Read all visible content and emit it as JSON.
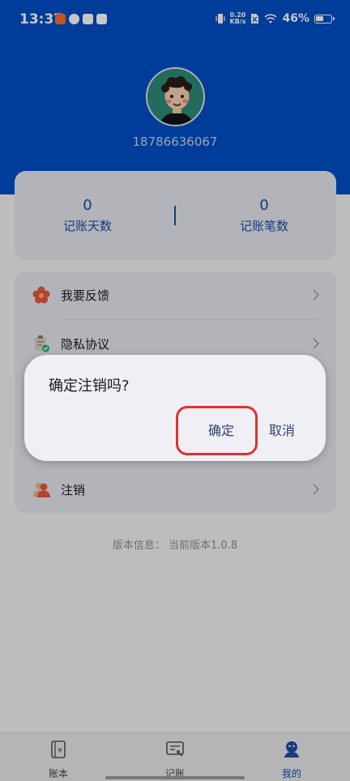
{
  "status": {
    "time": "13:37",
    "net_speed_value": "0.20",
    "net_speed_unit": "KB/s",
    "battery": "46%"
  },
  "profile": {
    "phone": "18786636067"
  },
  "stats": {
    "days_value": "0",
    "days_label": "记账天数",
    "entries_value": "0",
    "entries_label": "记账笔数"
  },
  "menu": {
    "items": [
      {
        "label": "我要反馈",
        "icon": "flower-icon"
      },
      {
        "label": "隐私协议",
        "icon": "clipboard-icon"
      },
      {
        "label": "注销",
        "icon": "users-icon"
      }
    ]
  },
  "version": "版本信息： 当前版本1.0.8",
  "dialog": {
    "title": "确定注销吗?",
    "confirm_label": "确定",
    "cancel_label": "取消"
  },
  "tabbar": {
    "tabs": [
      {
        "label": "账本",
        "icon": "ledger-icon"
      },
      {
        "label": "记账",
        "icon": "record-icon"
      },
      {
        "label": "我的",
        "icon": "profile-icon"
      }
    ]
  },
  "colors": {
    "brand_blue": "#004ec4",
    "accent_text": "#184f9e",
    "highlight_red": "#e03131"
  }
}
